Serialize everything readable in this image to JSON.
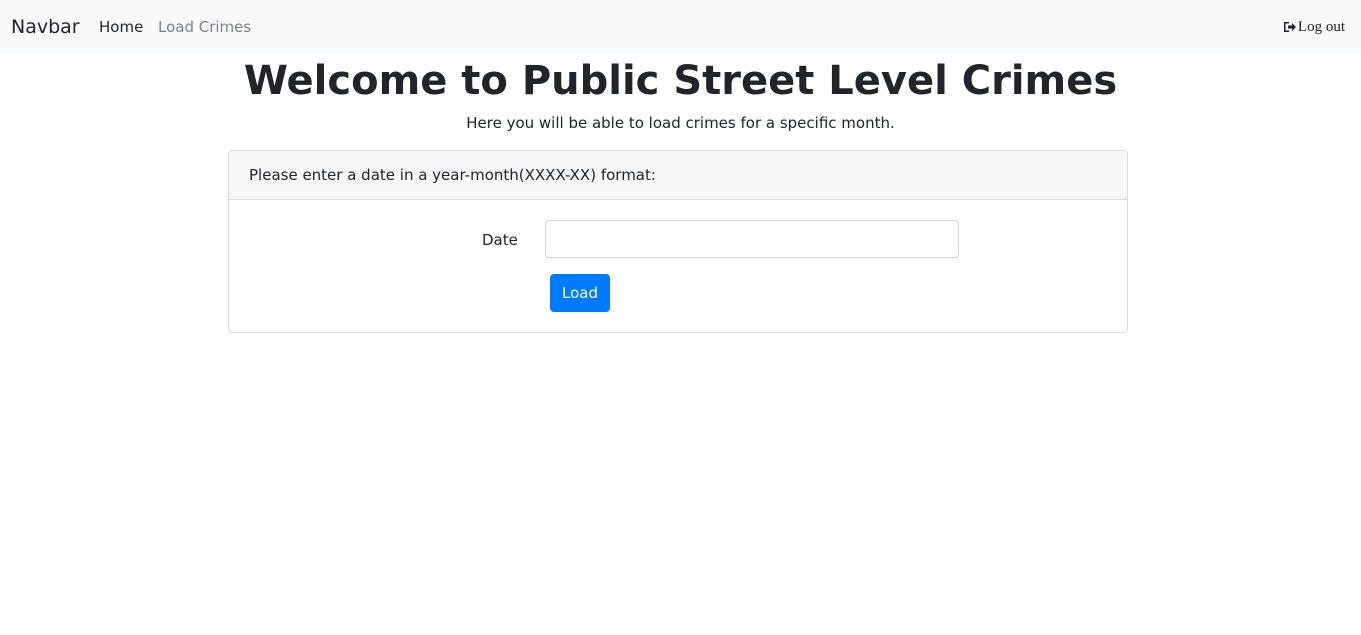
{
  "navbar": {
    "brand": "Navbar",
    "links": [
      {
        "label": "Home",
        "active": true
      },
      {
        "label": "Load Crimes",
        "active": false
      }
    ],
    "logout": {
      "label": "Log out",
      "icon": "sign-out-icon"
    }
  },
  "main": {
    "title": "Welcome to Public Street Level Crimes",
    "subtitle": "Here you will be able to load crimes for a specific month."
  },
  "form_card": {
    "header": "Please enter a date in a year-month(XXXX-XX) format:",
    "date_label": "Date",
    "date_value": "",
    "load_label": "Load"
  },
  "colors": {
    "navbar_bg": "#f8f9fa",
    "primary": "#007bff",
    "muted_link": "#7e8388"
  }
}
